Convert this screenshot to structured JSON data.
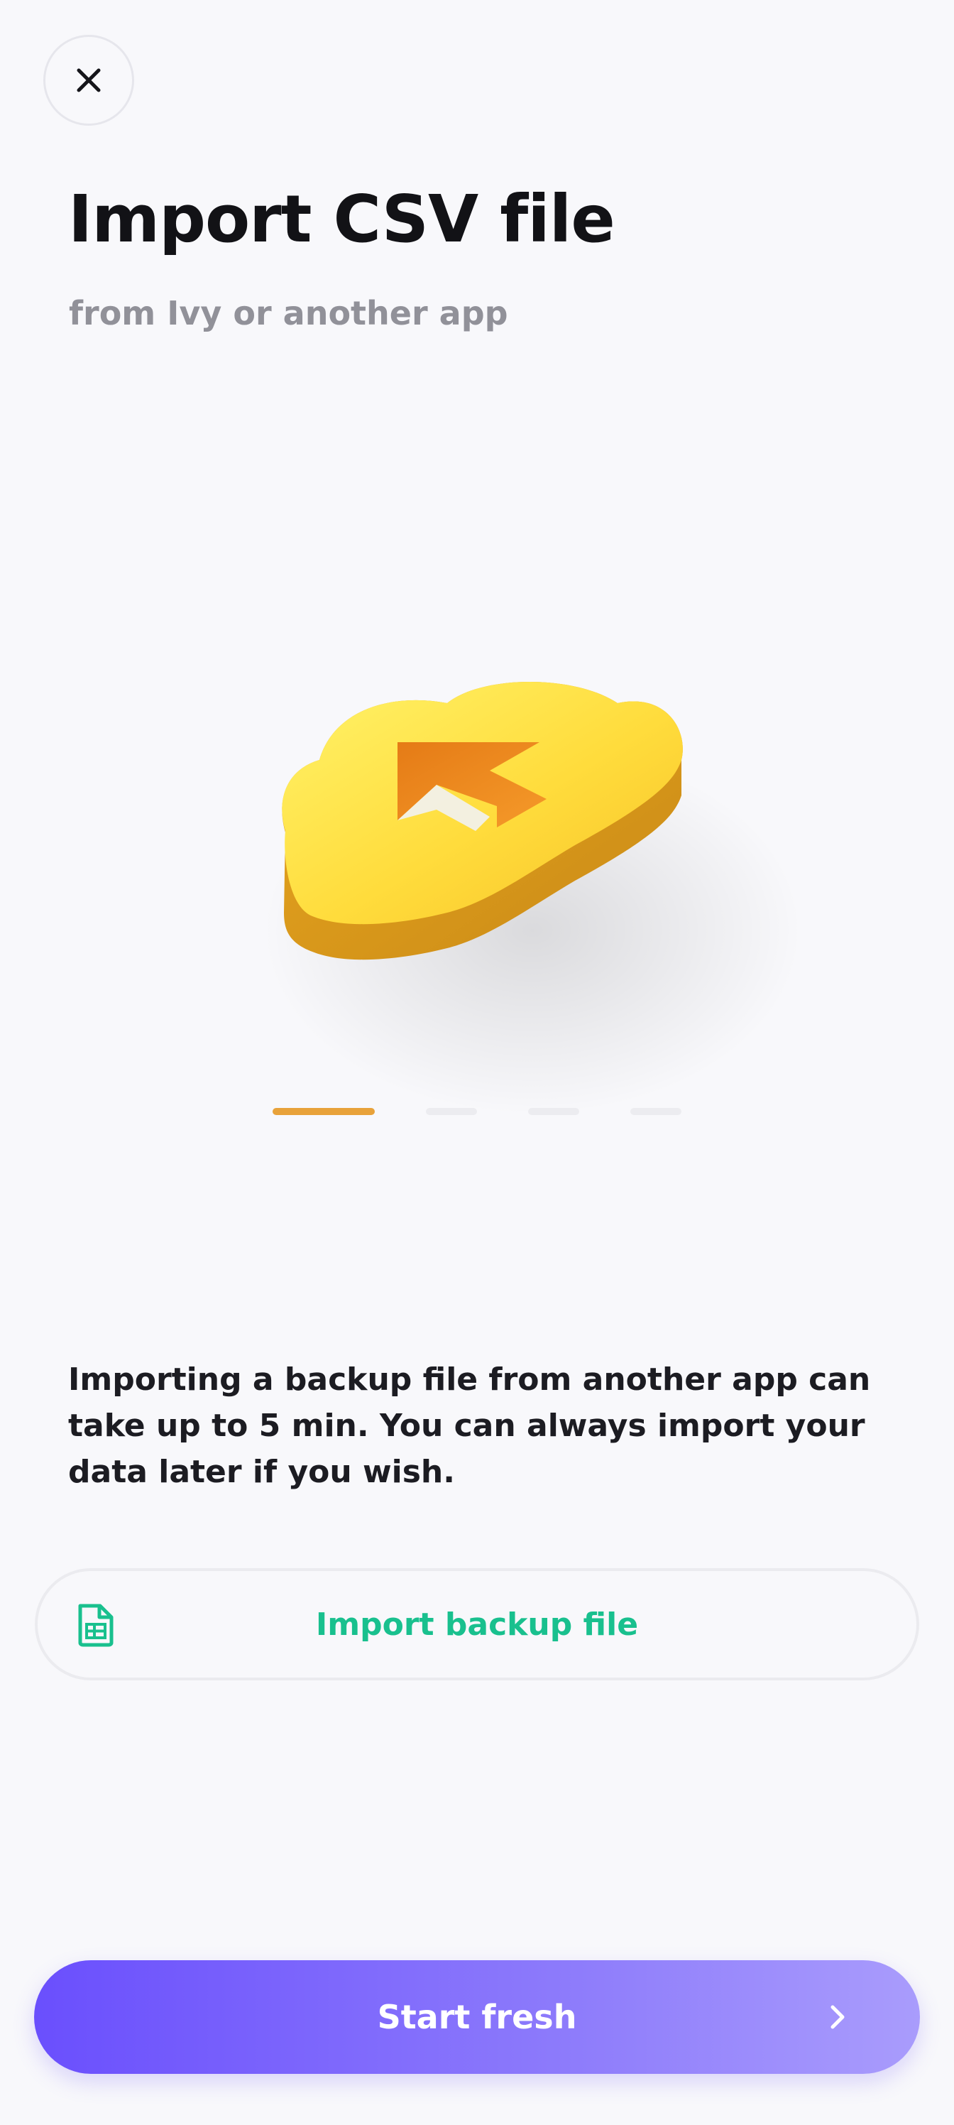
{
  "header": {
    "close_icon": "close-icon",
    "title": "Import CSV file",
    "subtitle": "from Ivy or another app"
  },
  "carousel": {
    "illustration_icon": "cloud-upload-icon",
    "page_count": 4,
    "active_page": 1,
    "active_color": "#e8a23a",
    "inactive_color": "#ececf0"
  },
  "description": "Importing a backup file from another app can take up to 5 min. You can always import your data later if you wish.",
  "import_button": {
    "icon": "file-spreadsheet-icon",
    "label": "Import backup file",
    "color": "#19c08e"
  },
  "start_button": {
    "label": "Start fresh",
    "icon": "chevron-right-icon",
    "gradient_start": "#6a4ffd",
    "gradient_end": "#a99cfc"
  }
}
